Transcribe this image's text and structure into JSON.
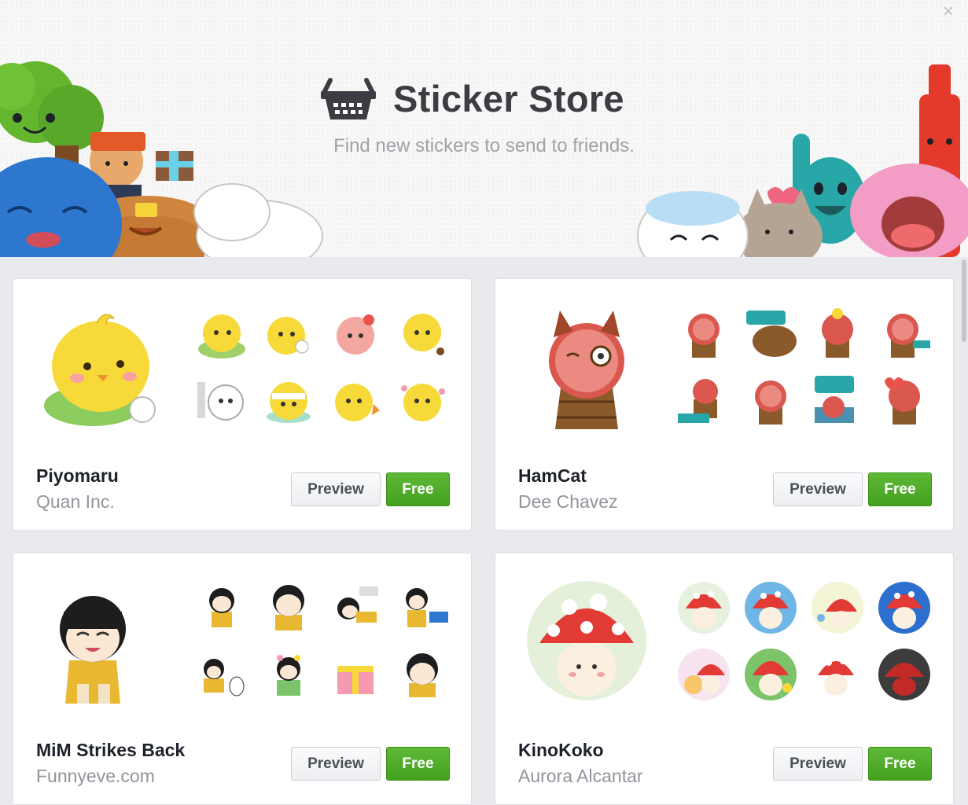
{
  "store": {
    "title": "Sticker Store",
    "subtitle": "Find new stickers to send to friends.",
    "close_icon": "×"
  },
  "packs": [
    {
      "name": "Piyomaru",
      "author": "Quan Inc.",
      "preview_label": "Preview",
      "price_label": "Free"
    },
    {
      "name": "HamCat",
      "author": "Dee Chavez",
      "preview_label": "Preview",
      "price_label": "Free"
    },
    {
      "name": "MiM Strikes Back",
      "author": "Funnyeve.com",
      "preview_label": "Preview",
      "price_label": "Free"
    },
    {
      "name": "KinoKoko",
      "author": "Aurora Alcantar",
      "preview_label": "Preview",
      "price_label": "Free"
    }
  ],
  "colors": {
    "free_button": "#4fae2a",
    "title_text": "#3b3d42",
    "subtitle_text": "#9ea1a6",
    "page_background": "#e9eaed"
  },
  "icons": {
    "store": "basket-icon",
    "close": "close-icon"
  }
}
